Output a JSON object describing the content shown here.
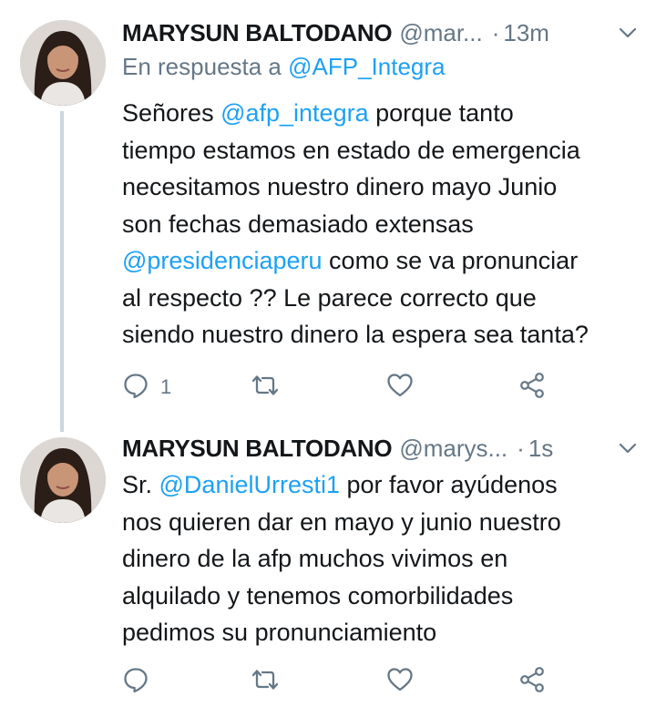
{
  "tweets": [
    {
      "author_name": "MARYSUN BALTODANO",
      "handle": "@mar...",
      "time": "13m",
      "reply_to_prefix": "En respuesta a",
      "reply_to_handle": "@AFP_Integra",
      "body_lines": [
        [
          {
            "text": "Señores "
          },
          {
            "text": "@afp_integra",
            "mention": true
          },
          {
            "text": " porque tanto"
          }
        ],
        [
          {
            "text": "tiempo estamos en estado de emergencia"
          }
        ],
        [
          {
            "text": "necesitamos nuestro dinero mayo Junio"
          }
        ],
        [
          {
            "text": "son fechas demasiado extensas"
          }
        ],
        [
          {
            "text": "@presidenciaperu",
            "mention": true
          },
          {
            "text": " como se va pronunciar"
          }
        ],
        [
          {
            "text": "al respecto ?? Le parece correcto que"
          }
        ],
        [
          {
            "text": "siendo nuestro dinero la espera sea tanta?"
          }
        ]
      ],
      "reply_count": "1"
    },
    {
      "author_name": "MARYSUN BALTODANO",
      "handle": "@marys...",
      "time": "1s",
      "body_lines": [
        [
          {
            "text": "Sr. "
          },
          {
            "text": "@DanielUrresti1",
            "mention": true
          },
          {
            "text": " por favor ayúdenos"
          }
        ],
        [
          {
            "text": "nos quieren dar en mayo y junio nuestro"
          }
        ],
        [
          {
            "text": "dinero de la afp muchos vivimos en"
          }
        ],
        [
          {
            "text": "alquilado y tenemos comorbilidades"
          }
        ],
        [
          {
            "text": "pedimos su pronunciamiento"
          }
        ]
      ],
      "reply_count": ""
    }
  ],
  "separator": "·",
  "icons": {
    "reply": "reply-icon",
    "retweet": "retweet-icon",
    "like": "heart-icon",
    "share": "share-icon",
    "menu": "chevron-down-icon"
  },
  "colors": {
    "mention": "#1da1f2",
    "secondary_text": "#657786",
    "primary_text": "#14171a",
    "thread_line": "#ccd6dd"
  }
}
